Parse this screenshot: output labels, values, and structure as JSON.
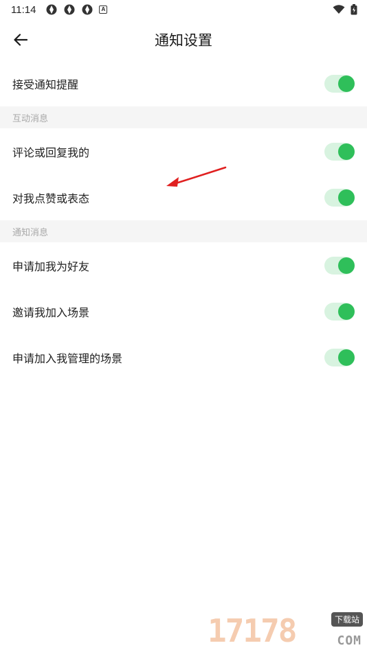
{
  "status_bar": {
    "time": "11:14",
    "a_label": "A"
  },
  "app_bar": {
    "title": "通知设置"
  },
  "top_setting": {
    "label": "接受通知提醒",
    "enabled": true
  },
  "sections": [
    {
      "header": "互动消息",
      "items": [
        {
          "label": "评论或回复我的",
          "enabled": true
        },
        {
          "label": "对我点赞或表态",
          "enabled": true
        }
      ]
    },
    {
      "header": "通知消息",
      "items": [
        {
          "label": "申请加我为好友",
          "enabled": true
        },
        {
          "label": "邀请我加入场景",
          "enabled": true
        },
        {
          "label": "申请加入我管理的场景",
          "enabled": true
        }
      ]
    }
  ],
  "colors": {
    "toggle_on_track": "#d8f3e0",
    "toggle_on_knob": "#2fbf5a",
    "section_bg": "#f5f5f5",
    "section_text": "#a8a8a8",
    "annotation_arrow": "#e02020"
  },
  "watermark": {
    "digits": "17178",
    "tag": "下载站",
    "domain": "COM"
  }
}
